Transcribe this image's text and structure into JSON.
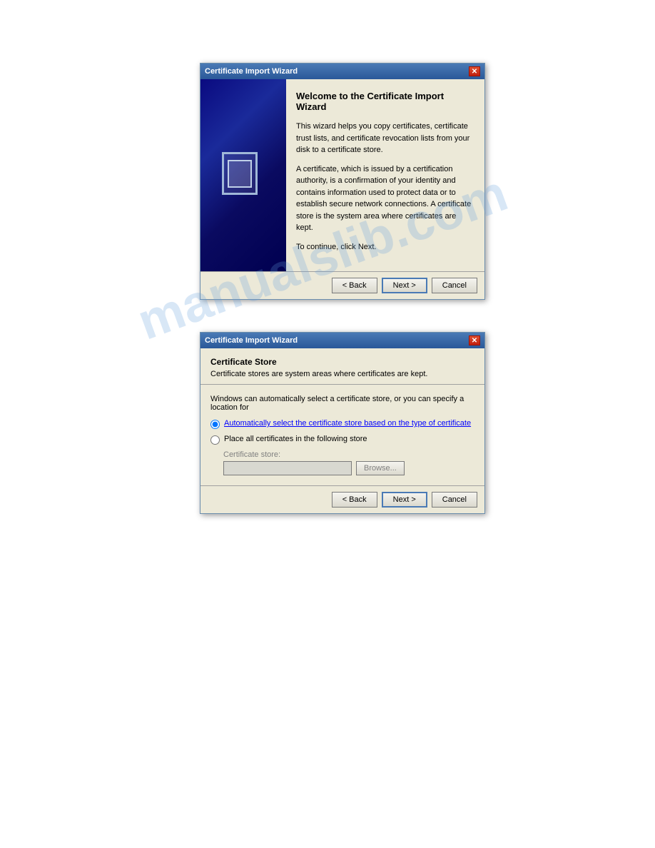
{
  "watermark": {
    "text": "manualslib.com"
  },
  "dialog1": {
    "title": "Certificate Import Wizard",
    "heading": "Welcome to the Certificate Import Wizard",
    "paragraph1": "This wizard helps you copy certificates, certificate trust lists, and certificate revocation lists from your disk to a certificate store.",
    "paragraph2": "A certificate, which is issued by a certification authority, is a confirmation of your identity and contains information used to protect data or to establish secure network connections. A certificate store is the system area where certificates are kept.",
    "paragraph3": "To continue, click Next.",
    "buttons": {
      "back": "< Back",
      "next": "Next >",
      "cancel": "Cancel"
    }
  },
  "dialog2": {
    "title": "Certificate Import Wizard",
    "section_title": "Certificate Store",
    "section_desc": "Certificate stores are system areas where certificates are kept.",
    "description": "Windows can automatically select a certificate store, or you can specify a location for",
    "radio1_label": "Automatically select the certificate store based on the type of certificate",
    "radio2_label": "Place all certificates in the following store",
    "cert_store_label": "Certificate store:",
    "browse_label": "Browse...",
    "buttons": {
      "back": "< Back",
      "next": "Next >",
      "cancel": "Cancel"
    }
  }
}
